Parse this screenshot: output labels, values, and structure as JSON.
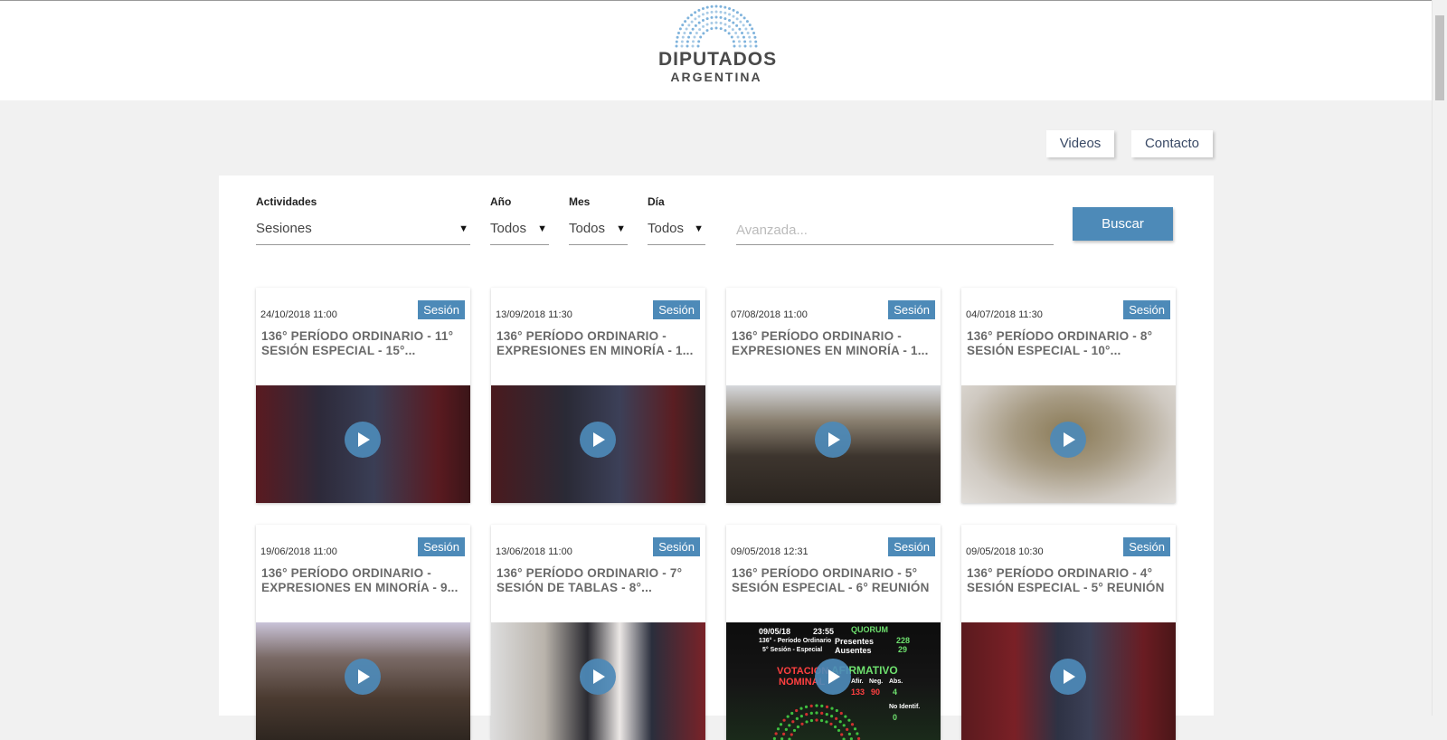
{
  "header": {
    "logo_title": "DIPUTADOS",
    "logo_subtitle": "ARGENTINA"
  },
  "nav": {
    "videos": "Videos",
    "contacto": "Contacto"
  },
  "filters": {
    "actividades": {
      "label": "Actividades",
      "value": "Sesiones"
    },
    "ano": {
      "label": "Año",
      "value": "Todos"
    },
    "mes": {
      "label": "Mes",
      "value": "Todos"
    },
    "dia": {
      "label": "Día",
      "value": "Todos"
    },
    "search_placeholder": "Avanzada...",
    "buscar": "Buscar",
    "arrow": "▼"
  },
  "cards": [
    {
      "date": "24/10/2018 11:00",
      "badge": "Sesión",
      "title": "136° PERÍODO ORDINARIO - 11° SESIÓN ESPECIAL - 15°..."
    },
    {
      "date": "13/09/2018 11:30",
      "badge": "Sesión",
      "title": "136° PERÍODO ORDINARIO - EXPRESIONES EN MINORÍA - 1..."
    },
    {
      "date": "07/08/2018 11:00",
      "badge": "Sesión",
      "title": "136° PERÍODO ORDINARIO - EXPRESIONES EN MINORÍA - 1..."
    },
    {
      "date": "04/07/2018 11:30",
      "badge": "Sesión",
      "title": "136° PERÍODO ORDINARIO - 8° SESIÓN ESPECIAL - 10°..."
    },
    {
      "date": "19/06/2018 11:00",
      "badge": "Sesión",
      "title": "136° PERÍODO ORDINARIO - EXPRESIONES EN MINORÍA - 9..."
    },
    {
      "date": "13/06/2018 11:00",
      "badge": "Sesión",
      "title": "136° PERÍODO ORDINARIO - 7° SESIÓN DE TABLAS - 8°..."
    },
    {
      "date": "09/05/2018 12:31",
      "badge": "Sesión",
      "title": "136° PERÍODO ORDINARIO - 5° SESIÓN ESPECIAL - 6° REUNIÓN"
    },
    {
      "date": "09/05/2018 10:30",
      "badge": "Sesión",
      "title": "136° PERÍODO ORDINARIO - 4° SESIÓN ESPECIAL - 5° REUNIÓN"
    }
  ],
  "vote_board": {
    "date": "09/05/18",
    "time": "23:55",
    "quorum": "QUORUM",
    "periodo": "136° - Período Ordinario",
    "sesion": "5° Sesión - Especial",
    "presentes_label": "Presentes",
    "presentes": "228",
    "ausentes_label": "Ausentes",
    "ausentes": "29",
    "votacion": "VOTACION",
    "nominal": "NOMINAL",
    "afirmativo": "AFIRMATIVO",
    "afir_label": "Afir.",
    "neg_label": "Neg.",
    "abs_label": "Abs.",
    "afir": "133",
    "neg": "90",
    "abs": "4",
    "no_ident_label": "No Identif.",
    "no_ident": "0"
  },
  "colors": {
    "accent": "#4d8ab8",
    "page_bg": "#f1f1f1",
    "title_text": "#6a6a6a"
  }
}
